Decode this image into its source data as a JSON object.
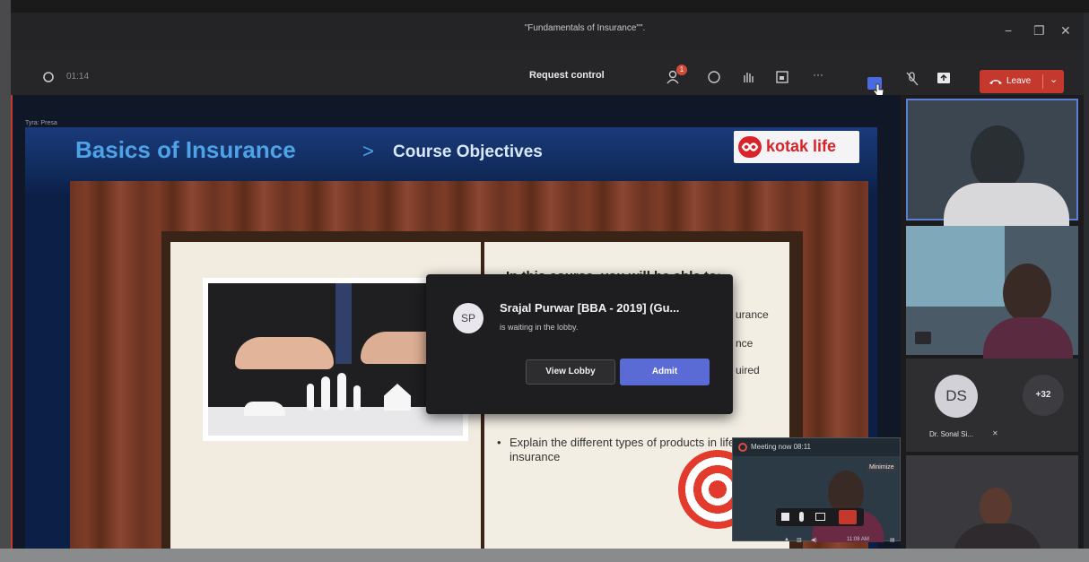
{
  "window": {
    "title": "\"Fundamentals of Insurance\"\"."
  },
  "toolbar": {
    "timer": "01:14",
    "request_control": "Request control",
    "participants_badge": "1",
    "more": "···",
    "leave_label": "Leave"
  },
  "stage": {
    "presenter_label": "Tyra: Presa"
  },
  "slide": {
    "title_main": "Basics of Insurance",
    "title_chevron": ">",
    "title_sub": "Course Objectives",
    "brand": "kotak life",
    "heading": "In this course, you will be able to:",
    "bullet_fragments": [
      "urance",
      "nce",
      "uired"
    ],
    "bullet_last": "Explain the different types of products in life insurance",
    "bullet_marker": "•"
  },
  "lobby_popup": {
    "avatar_initials": "SP",
    "name": "Srajal Purwar [BBA - 2019] (Gu...",
    "message": "is waiting in the lobby.",
    "view_lobby_label": "View Lobby",
    "admit_label": "Admit"
  },
  "gallery": {
    "participant_initials": "DS",
    "participant_name": "Dr. Sonal Si...",
    "more_count": "+32"
  },
  "mini_window": {
    "title": "Meeting now   08:11",
    "tooltip": "Minimize"
  },
  "taskbar": {
    "time": "11:08 AM"
  },
  "colors": {
    "leave_red": "#c4382e",
    "admit_blue": "#5b6bd6",
    "slide_title_blue": "#4ea2e6",
    "brand_red": "#d8232a"
  }
}
